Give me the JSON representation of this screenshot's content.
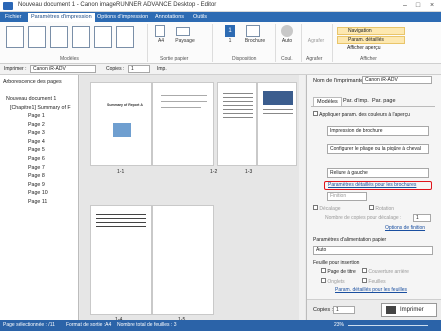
{
  "window": {
    "title": "Nouveau document 1 - Canon imageRUNNER ADVANCE Desktop - Editor"
  },
  "menu": {
    "items": [
      "Fichier",
      "Paramètres d'impression",
      "Options d'impression",
      "Annotations",
      "Outils"
    ]
  },
  "ribbon": {
    "groups": [
      "Modèles",
      "Sortie papier",
      "Disposition",
      "Coul.",
      "Agrafer",
      "Afficher"
    ],
    "buttons": {
      "size": "A4",
      "orient": "Paysage",
      "count": "1",
      "brochure": "Brochure",
      "auto": "Auto",
      "staple": "Agrafer",
      "nav": "Navigation",
      "details": "Param. détaillés",
      "fit": "Afficher aperçu"
    }
  },
  "toolbar2": {
    "printer_label": "Imprimer :",
    "printer": "Canon iR-ADV",
    "copies_label": "Copies :",
    "copies": "1",
    "imp": "Imp."
  },
  "tree": {
    "heading": "Arborescence des pages",
    "doc": "Nouveau document 1",
    "chapter": "[Chapitre1] Summary of F",
    "pages": [
      "Page 1",
      "Page 2",
      "Page 3",
      "Page 4",
      "Page 5",
      "Page 6",
      "Page 7",
      "Page 8",
      "Page 9",
      "Page 10",
      "Page 11"
    ]
  },
  "thumbs": {
    "labels": [
      "1-1",
      "1-2",
      "1-3",
      "1-4",
      "1-5"
    ],
    "cover_title": "Summary of Report A"
  },
  "settings": {
    "printer_label": "Nom de l'imprimante :",
    "printer": "Canon iR-ADV",
    "tabs": [
      "Modèles",
      "Par. d'imp.",
      "Par. page"
    ],
    "apply_colors": "Appliquer param. des couleurs à l'aperçu",
    "print_mode": "Impression de brochure",
    "config": "Configurer le pliage ou la piqûre à cheval",
    "binding": "Reliure à gauche",
    "brochure_link": "Paramètres détaillés pour les brochures",
    "finishing": "Finition",
    "decalage": "Décalage",
    "rotation": "Rotation",
    "offset_label": "Nombre de copies pour décalage :",
    "offset_value": "1",
    "finition_opts": "Options de finition",
    "paper_label": "Paramètres d'alimentation papier",
    "paper": "Auto",
    "inserts_label": "Feuille pour insertion",
    "page_titre": "Page de titre",
    "couverture": "Couverture arrière",
    "onglets": "Onglets",
    "feuilles": "Feuilles",
    "inserts_link": "Param. détaillés pour les feuilles",
    "copies_label": "Copies :",
    "copies": "1",
    "print_btn": "Imprimer"
  },
  "status": {
    "left": "Page sélectionnée : /11",
    "format": "Format de sortie :A4",
    "sheets": "Nombre total de feuilles : 3",
    "zoom": "23%"
  }
}
